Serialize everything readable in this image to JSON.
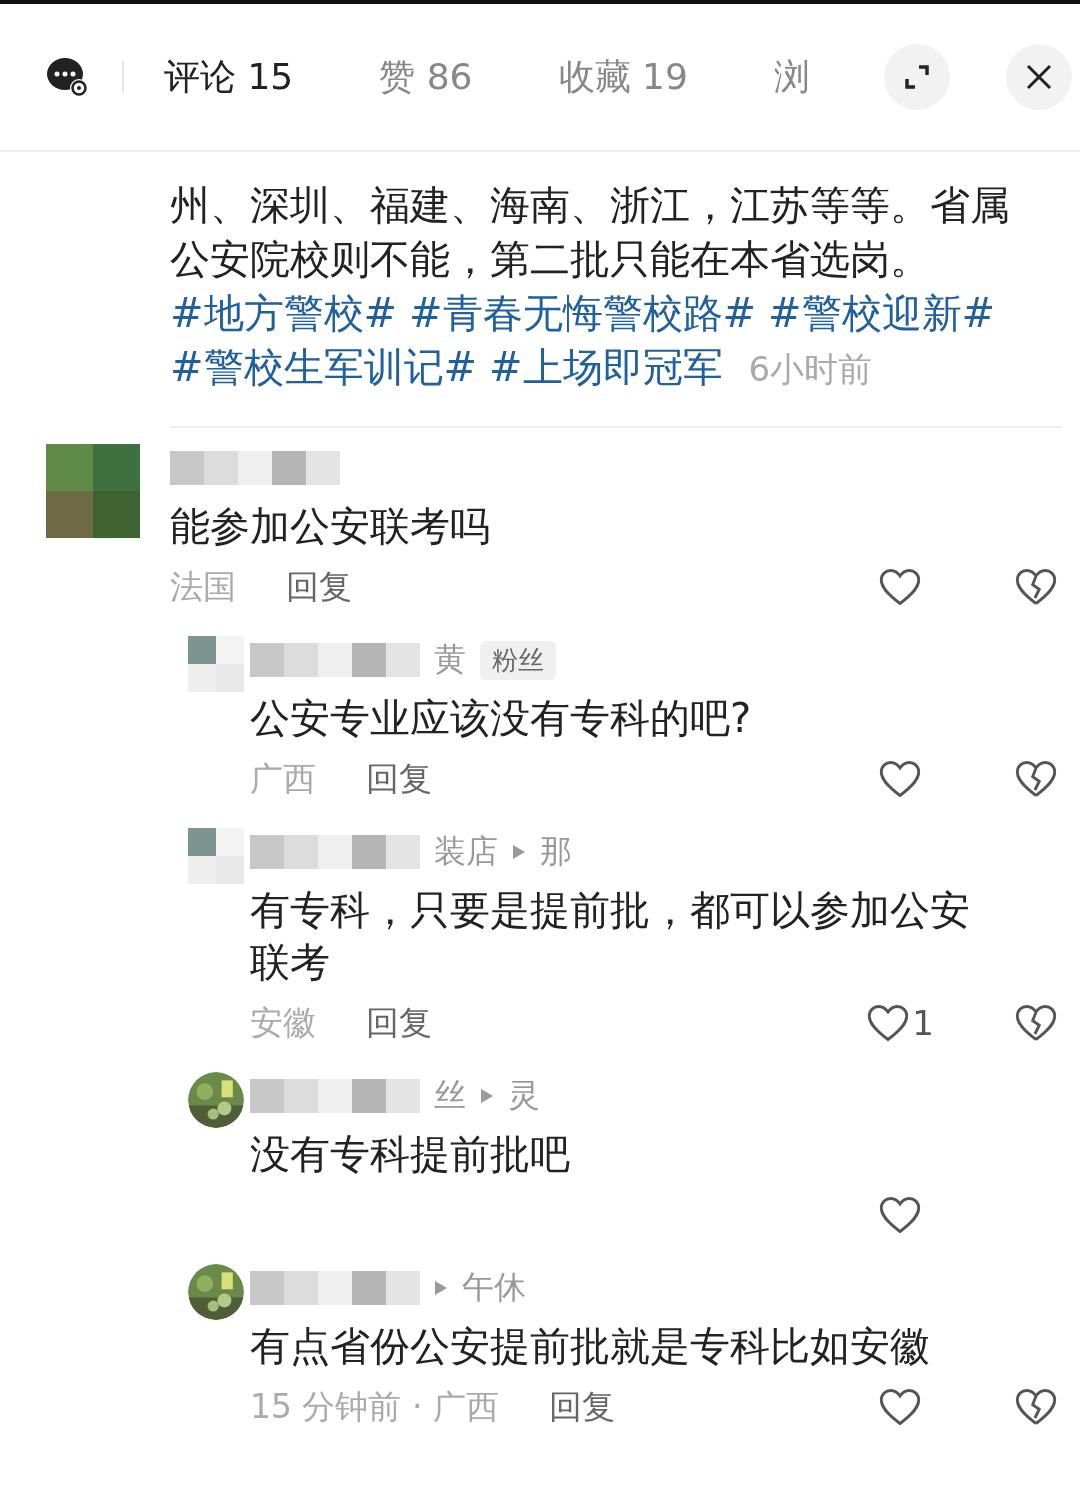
{
  "header": {
    "tabs": [
      {
        "label": "评论 15",
        "selected": true
      },
      {
        "label": "赞 86",
        "selected": false
      },
      {
        "label": "收藏 19",
        "selected": false
      },
      {
        "label": "浏",
        "selected": false
      }
    ]
  },
  "post": {
    "text": "州、深圳、福建、海南、浙江，江苏等等。省属公安院校则不能，第二批只能在本省选岗。",
    "hashtags": [
      "#地方警校#",
      "#青春无悔警校路#",
      "#警校迎新#",
      "#警校生军训记#",
      "#上场即冠军"
    ],
    "time": "6小时前"
  },
  "comments": [
    {
      "kind": "top",
      "avatar_pixelated": true,
      "text": "能参加公安联考吗",
      "meta": "法国",
      "reply": "回复",
      "dislike_shown": true
    },
    {
      "kind": "reply",
      "avatar_pixelated": true,
      "name": "黄",
      "badge": "粉丝",
      "text": "公安专业应该没有专科的吧?",
      "meta": "广西",
      "reply": "回复",
      "dislike_shown": true
    },
    {
      "kind": "reply",
      "avatar_pixelated": true,
      "name": "装店",
      "reply_to": "那",
      "text": "有专科，只要是提前批，都可以参加公安联考",
      "meta": "安徽",
      "reply": "回复",
      "likes": "1",
      "dislike_shown": true
    },
    {
      "kind": "reply",
      "avatar_pixelated": false,
      "name": "丝",
      "reply_to": "灵",
      "text": "没有专科提前批吧",
      "dislike_shown": false
    },
    {
      "kind": "reply",
      "avatar_pixelated": false,
      "reply_to": "午休",
      "text": "有点省份公安提前批就是专科比如安徽",
      "meta": "15 分钟前 · 广西",
      "reply": "回复",
      "dislike_shown": true
    }
  ]
}
